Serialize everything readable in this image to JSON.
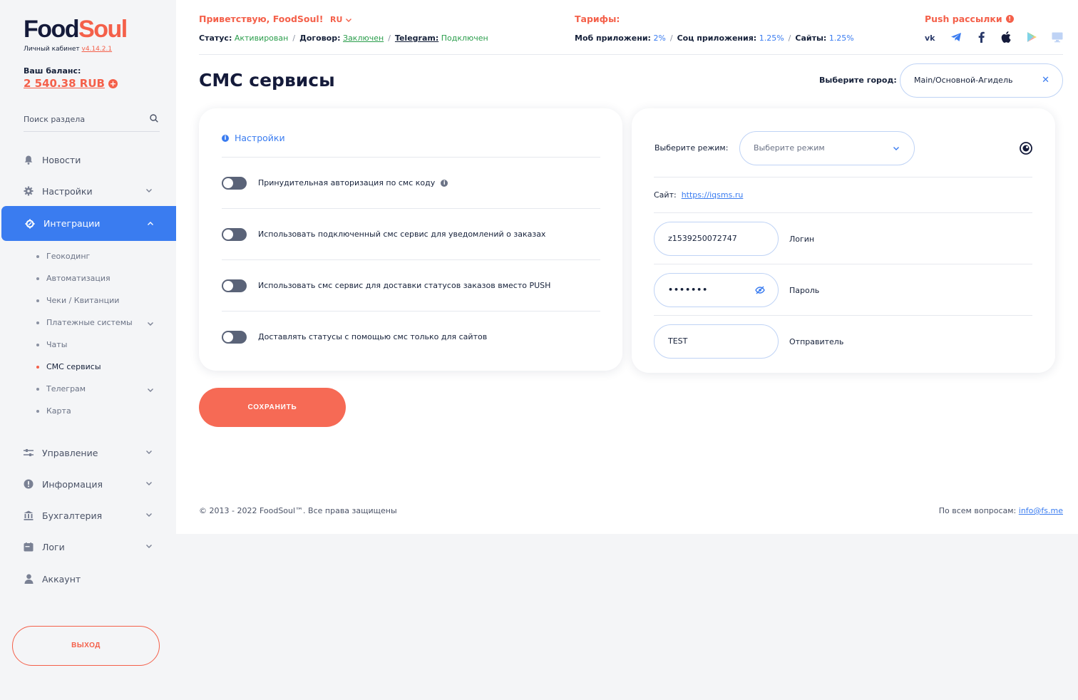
{
  "brand": {
    "name_part1": "Food",
    "name_part2": "Soul",
    "cabinet_label": "Личный кабинет",
    "version": "v4.14.2.1"
  },
  "balance": {
    "label": "Ваш баланс:",
    "value": "2 540.38 RUB"
  },
  "search": {
    "placeholder": "Поиск раздела"
  },
  "nav": {
    "news": "Новости",
    "settings": "Настройки",
    "integrations": "Интеграции",
    "integrations_sub": [
      "Геокодинг",
      "Автоматизация",
      "Чеки / Квитанции",
      "Платежные системы",
      "Чаты",
      "СМС сервисы",
      "Телеграм",
      "Карта"
    ],
    "management": "Управление",
    "information": "Информация",
    "accounting": "Бухгалтерия",
    "logs": "Логи",
    "account": "Аккаунт",
    "logout": "ВЫХОД"
  },
  "header": {
    "greeting": "Приветствую, FoodSoul!",
    "lang": "RU",
    "status_label": "Статус:",
    "status_value": "Активирован",
    "contract_label": "Договор:",
    "contract_value": "Заключен",
    "telegram_label": "Telegram:",
    "telegram_value": "Подключен",
    "tariffs_title": "Тарифы:",
    "mob_label": "Моб приложени:",
    "mob_value": "2%",
    "soc_label": "Соц приложения:",
    "soc_value": "1.25%",
    "sites_label": "Сайты:",
    "sites_value": "1.25%",
    "push_title": "Push рассылки"
  },
  "page": {
    "title": "СМС сервисы",
    "city_label": "Выберите город:",
    "city_value": "Main/Основной-Агидель"
  },
  "settings_card": {
    "title": "Настройки",
    "toggles": [
      {
        "label": "Принудительная авторизация по смс коду",
        "on": false
      },
      {
        "label": "Использовать подключенный смс сервис для уведомлений о заказах",
        "on": false
      },
      {
        "label": "Использовать смс сервис для доставки статусов заказов вместо PUSH",
        "on": false
      },
      {
        "label": "Доставлять статусы с помощью смс только для сайтов",
        "on": false
      }
    ]
  },
  "service_card": {
    "mode_label": "Выберите режим:",
    "mode_placeholder": "Выберите режим",
    "site_label": "Сайт:",
    "site_url": "https://iqsms.ru",
    "login_value": "z1539250072747",
    "login_label": "Логин",
    "password_value": "•••••••",
    "password_label": "Пароль",
    "sender_value": "TEST",
    "sender_label": "Отправитель"
  },
  "save_label": "СОХРАНИТЬ",
  "footer": {
    "copyright": "© 2013 - 2022 FoodSoul™. Все права защищены",
    "contact_label": "По всем вопросам:",
    "contact_email": "info@fs.me"
  },
  "colors": {
    "accent": "#f4604a",
    "primary": "#3a7cf0",
    "success": "#2a9d4b",
    "text": "#16213a"
  }
}
